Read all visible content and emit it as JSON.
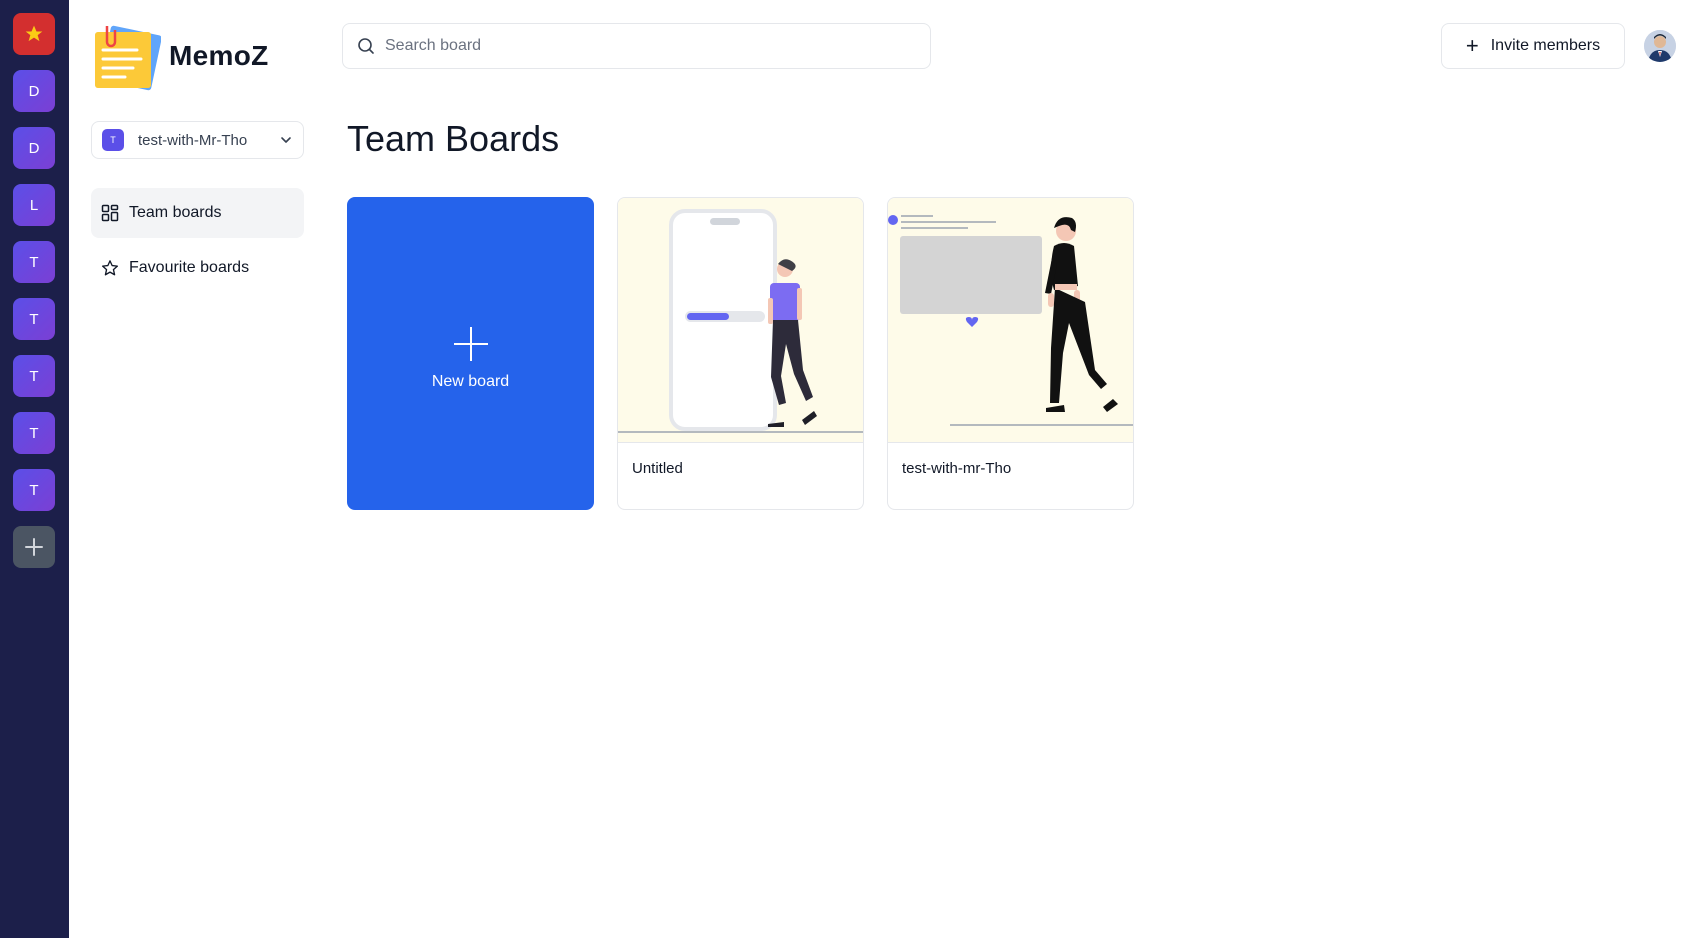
{
  "app": {
    "name": "MemoZ"
  },
  "rail": {
    "items": [
      {
        "label": "",
        "kind": "star"
      },
      {
        "label": "D",
        "kind": "org"
      },
      {
        "label": "D",
        "kind": "org"
      },
      {
        "label": "L",
        "kind": "org"
      },
      {
        "label": "T",
        "kind": "org"
      },
      {
        "label": "T",
        "kind": "org"
      },
      {
        "label": "T",
        "kind": "org"
      },
      {
        "label": "T",
        "kind": "org"
      },
      {
        "label": "T",
        "kind": "org"
      }
    ]
  },
  "workspace": {
    "badge": "T",
    "name": "test-with-Mr-Tho"
  },
  "nav": [
    {
      "label": "Team boards",
      "icon": "grid-icon",
      "active": true
    },
    {
      "label": "Favourite boards",
      "icon": "star-icon",
      "active": false
    }
  ],
  "search": {
    "placeholder": "Search board",
    "value": ""
  },
  "header": {
    "invite_label": "Invite members"
  },
  "main": {
    "title": "Team Boards",
    "new_board_label": "New board",
    "boards": [
      {
        "title": "Untitled",
        "illustration": "phone-progress-illustration"
      },
      {
        "title": "test-with-mr-Tho",
        "illustration": "presentation-illustration"
      }
    ]
  },
  "colors": {
    "rail_bg": "#1c1f4a",
    "accent": "#2563eb",
    "org_badge": "#5b4fe8",
    "star_badge": "#d32f2f",
    "thumb_bg": "#fefbe9"
  }
}
